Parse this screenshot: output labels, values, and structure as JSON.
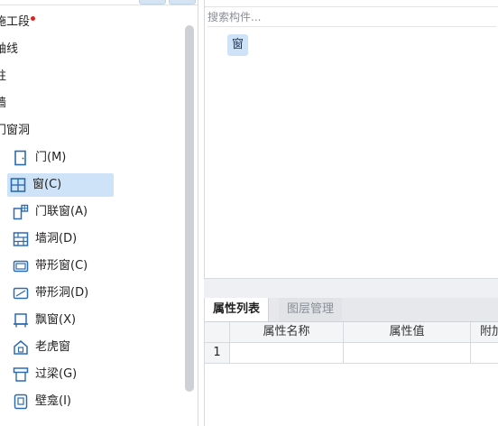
{
  "tree": {
    "top_items": [
      {
        "label": "施工段",
        "marker": true
      },
      {
        "label": "轴线"
      },
      {
        "label": "柱"
      },
      {
        "label": "墙"
      },
      {
        "label": "门窗洞"
      }
    ],
    "children": [
      {
        "label": "门(M)",
        "icon": "door-icon"
      },
      {
        "label": "窗(C)",
        "icon": "window-icon",
        "selected": true
      },
      {
        "label": "门联窗(A)",
        "icon": "door-window-icon"
      },
      {
        "label": "墙洞(D)",
        "icon": "wall-opening-icon"
      },
      {
        "label": "带形窗(C)",
        "icon": "strip-window-icon"
      },
      {
        "label": "带形洞(D)",
        "icon": "strip-opening-icon"
      },
      {
        "label": "飘窗(X)",
        "icon": "bay-window-icon"
      },
      {
        "label": "老虎窗",
        "icon": "dormer-window-icon"
      },
      {
        "label": "过梁(G)",
        "icon": "lintel-icon"
      },
      {
        "label": "壁龛(I)",
        "icon": "niche-icon"
      }
    ]
  },
  "component_panel": {
    "search_placeholder": "搜索构件...",
    "items": [
      "窗"
    ]
  },
  "property_panel": {
    "tabs": [
      "属性列表",
      "图层管理"
    ],
    "columns": [
      "属性名称",
      "属性值",
      "附加"
    ],
    "rows": [
      [
        "1",
        "",
        "",
        ""
      ]
    ]
  },
  "colors": {
    "accent": "#2b6cb0",
    "selection": "#cfe3f8",
    "marker": "#e02020"
  }
}
